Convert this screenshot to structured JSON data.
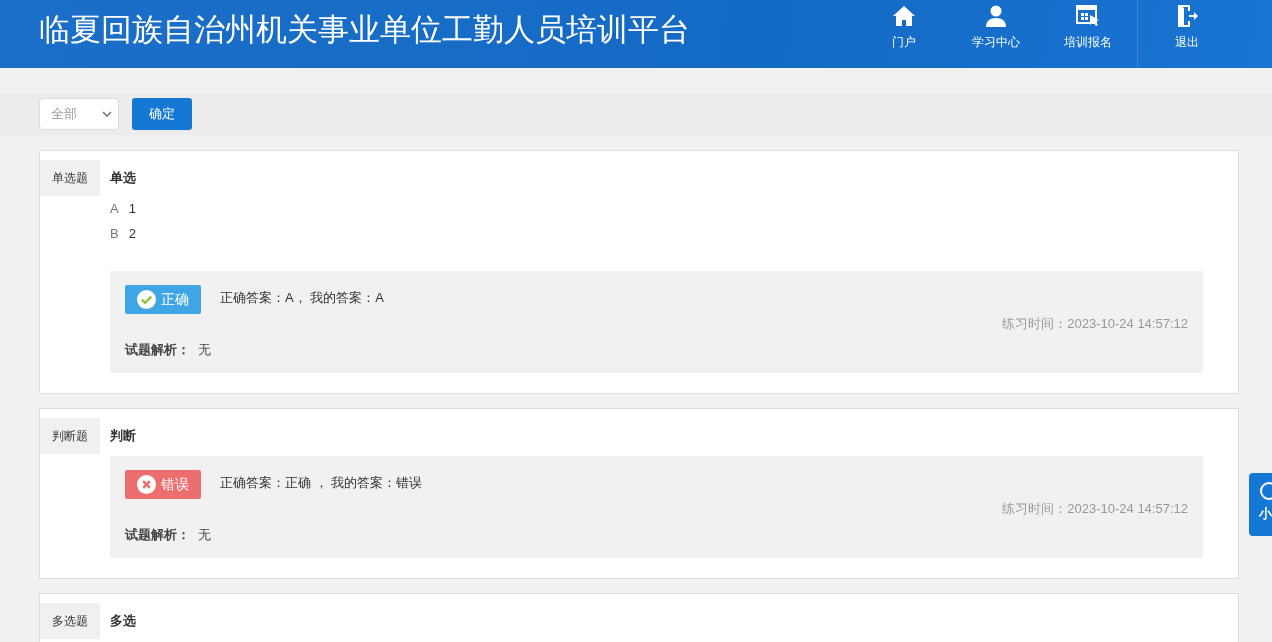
{
  "header": {
    "title": "临夏回族自治州机关事业单位工勤人员培训平台",
    "nav": [
      {
        "kind": "home",
        "label": "门户"
      },
      {
        "kind": "user",
        "label": "学习中心"
      },
      {
        "kind": "register",
        "label": "培训报名"
      },
      {
        "kind": "logout",
        "label": "退出"
      }
    ]
  },
  "filter": {
    "select_value": "全部",
    "button": "确定"
  },
  "questions": [
    {
      "type_label": "单选题",
      "title": "单选",
      "options": [
        {
          "letter": "A",
          "text": "1"
        },
        {
          "letter": "B",
          "text": "2"
        }
      ],
      "result": {
        "correct": true,
        "badge": "正确",
        "answer_text": "正确答案：A， 我的答案：A",
        "time": "练习时间：2023-10-24 14:57:12",
        "analysis_label": "试题解析：",
        "analysis": "无"
      }
    },
    {
      "type_label": "判断题",
      "title": "判断",
      "result": {
        "correct": false,
        "badge": "错误",
        "answer_text": "正确答案：正确 ， 我的答案：错误",
        "time": "练习时间：2023-10-24 14:57:12",
        "analysis_label": "试题解析：",
        "analysis": "无"
      }
    },
    {
      "type_label": "多选题",
      "title": "多选"
    }
  ],
  "float_tab": {
    "label": "小"
  }
}
